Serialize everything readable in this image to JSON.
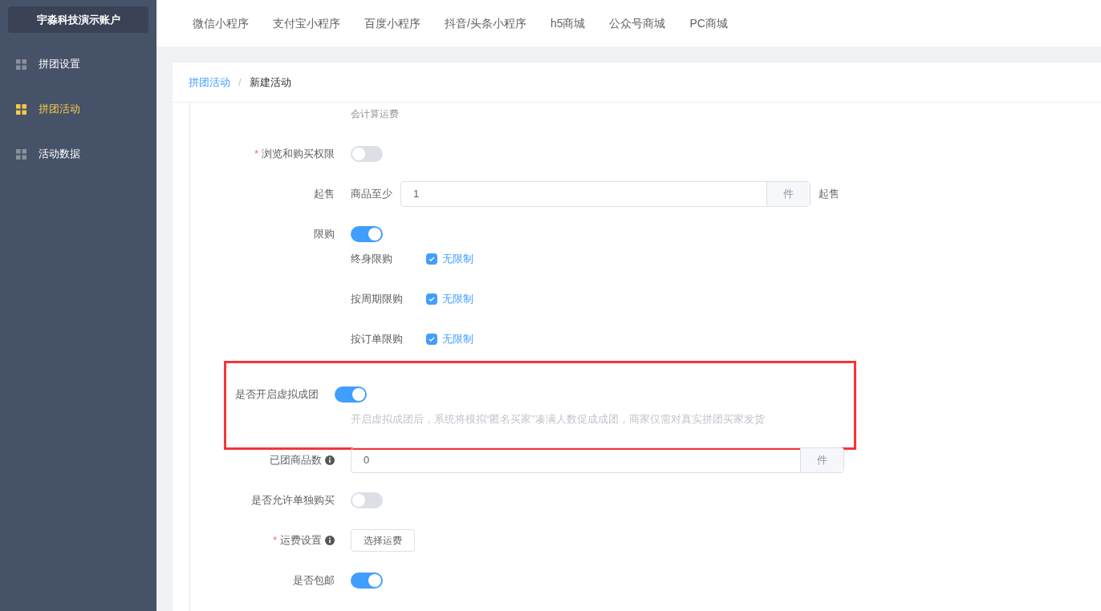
{
  "sidebar": {
    "account": "宇淼科技演示账户",
    "items": [
      {
        "label": "拼团设置",
        "selected": false
      },
      {
        "label": "拼团活动",
        "selected": true
      },
      {
        "label": "活动数据",
        "selected": false
      }
    ]
  },
  "top_nav": [
    "微信小程序",
    "支付宝小程序",
    "百度小程序",
    "抖音/头条小程序",
    "h5商城",
    "公众号商城",
    "PC商城"
  ],
  "breadcrumb": [
    "拼团活动",
    "新建活动"
  ],
  "breadcrumb_separator": "/",
  "form_rows": [
    {
      "kind": "hint",
      "text": "会计算运费"
    },
    {
      "kind": "switch",
      "label": "浏览和购买权限",
      "required_mark": "*",
      "on": false
    },
    {
      "kind": "quantity",
      "label": "起售",
      "prefix": "商品至少",
      "value": "1",
      "unit": "件",
      "suffix": "起售"
    },
    {
      "kind": "switch",
      "label": "限购",
      "on": true
    },
    {
      "kind": "limit",
      "label": "终身限购",
      "checked": true,
      "option": "无限制"
    },
    {
      "kind": "limit",
      "label": "按周期限购",
      "checked": true,
      "option": "无限制"
    },
    {
      "kind": "limit",
      "label": "按订单限购",
      "checked": true,
      "option": "无限制"
    },
    {
      "kind": "switch",
      "label": "是否开启虚拟成团",
      "on": true,
      "hint": "开启虚拟成团后，系统将模拟“匿名买家”凑满人数促成成团，商家仅需对真实拼团买家发货",
      "highlighted": true
    },
    {
      "kind": "input",
      "label": "已团商品数",
      "info": true,
      "value": "0",
      "unit": "件"
    },
    {
      "kind": "switch",
      "label": "是否允许单独购买",
      "on": false
    },
    {
      "kind": "button",
      "label": "运费设置",
      "required_mark": "*",
      "info": true,
      "button": "选择运费"
    },
    {
      "kind": "switch",
      "label": "是否包邮",
      "on": true
    }
  ]
}
